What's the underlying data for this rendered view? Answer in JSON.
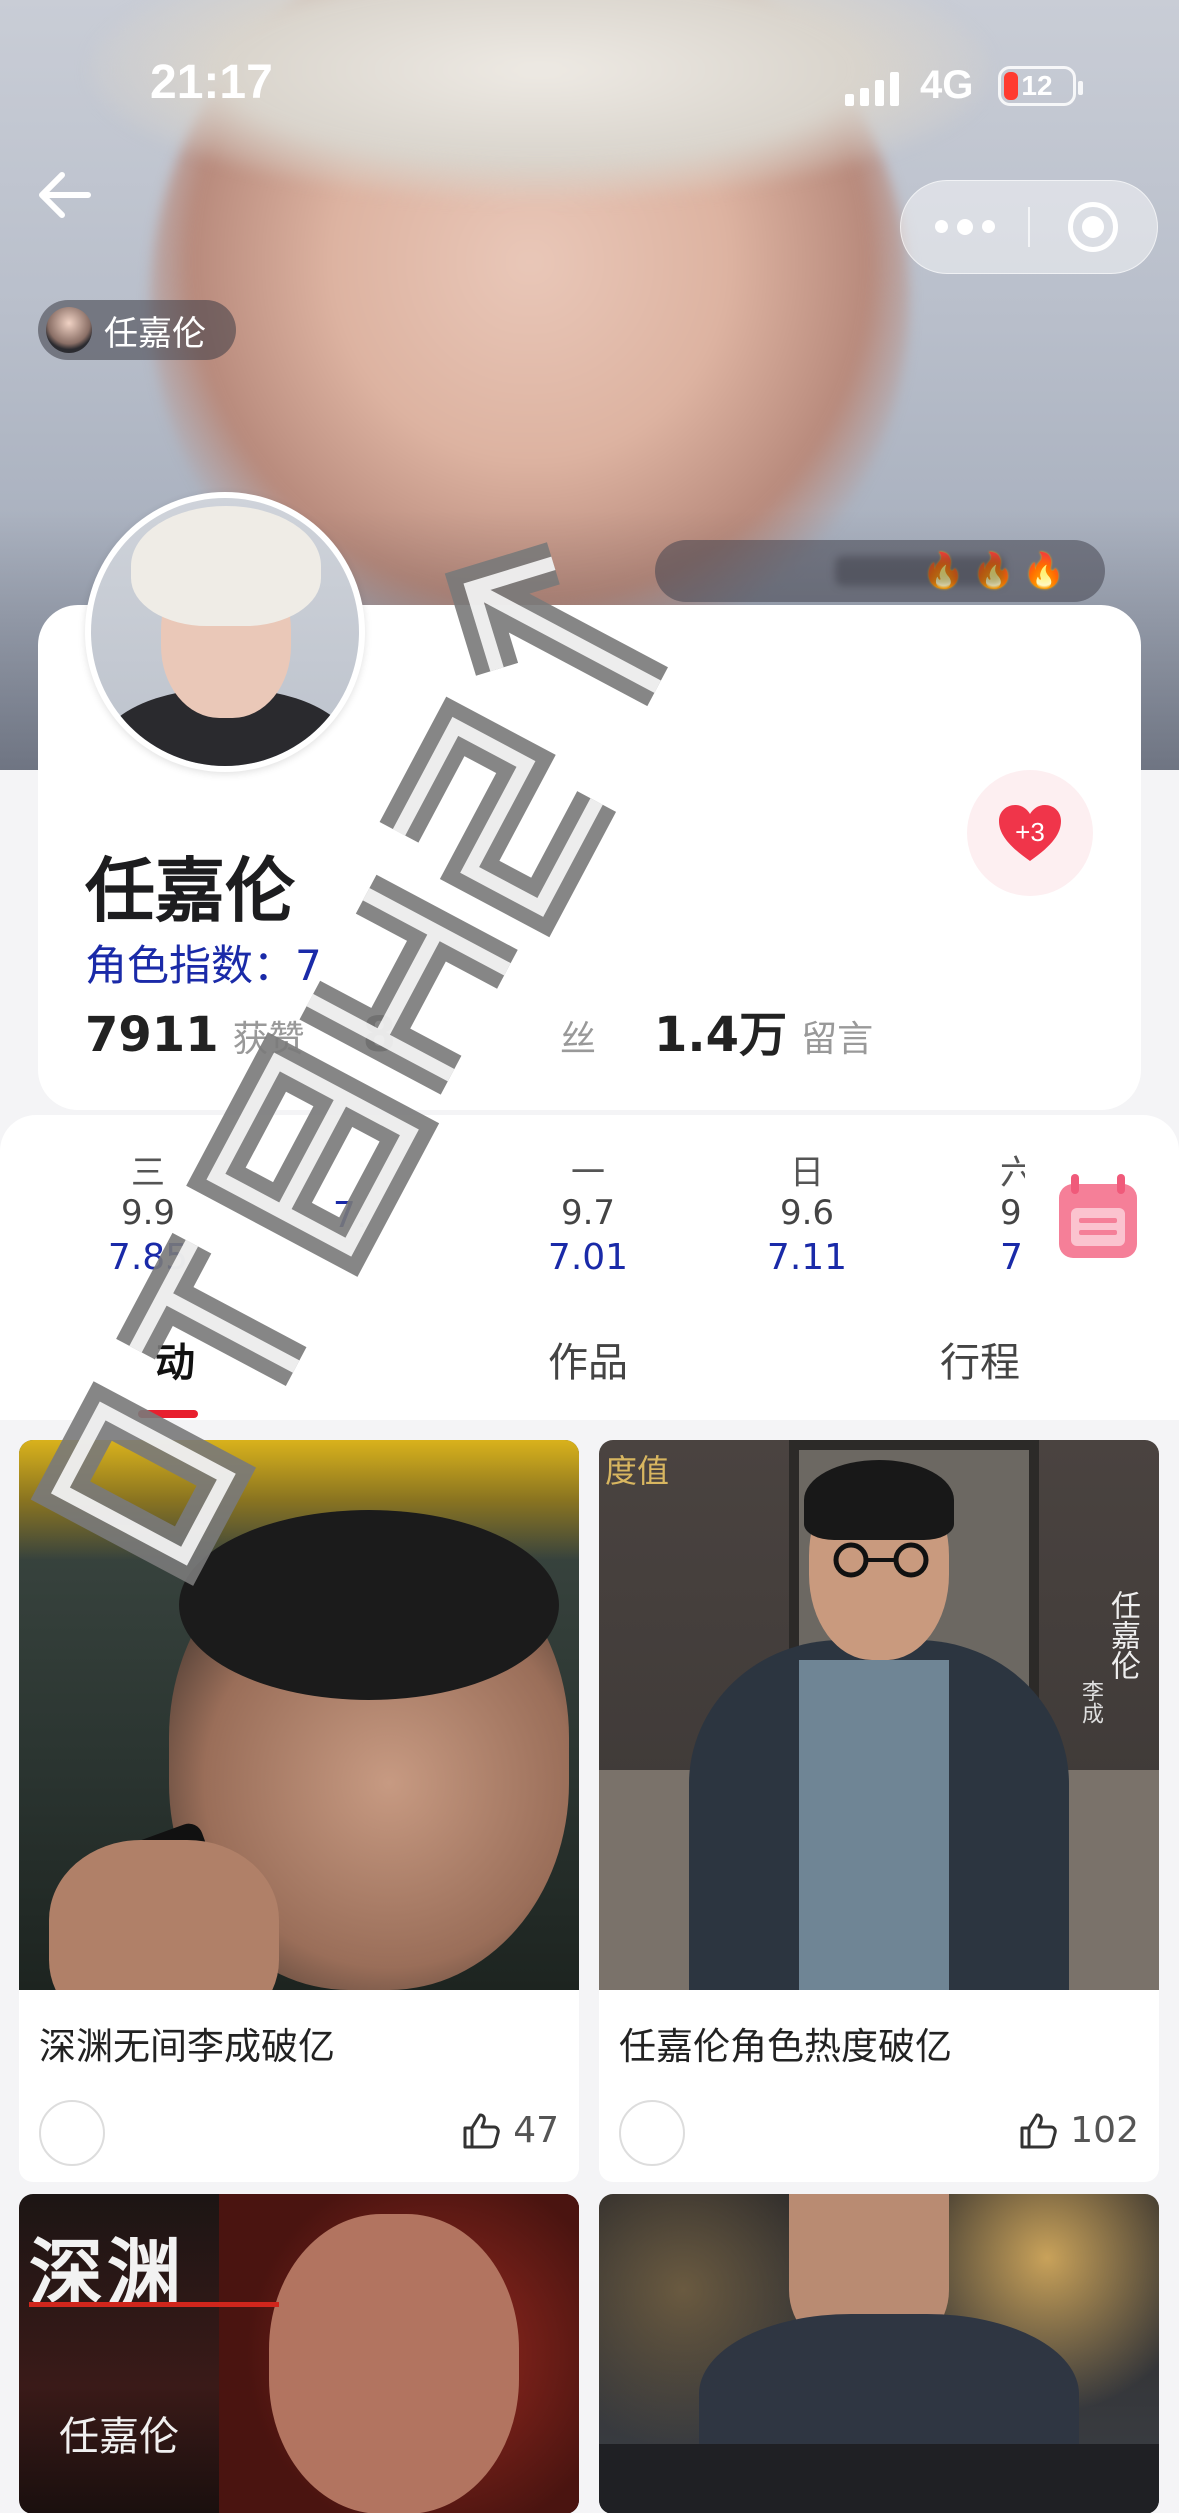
{
  "status_bar": {
    "time": "21:17",
    "network": "4G",
    "battery_level": "12",
    "battery_color": "#ff3b30"
  },
  "header": {
    "back_icon": "arrow-left-icon",
    "more_icon": "ellipsis-icon",
    "close_icon": "target-icon",
    "chip_name": "任嘉伦",
    "hot_flames": [
      "🔥",
      "🔥",
      "🔥"
    ]
  },
  "profile": {
    "name": "任嘉伦",
    "role_index_label": "角色指数：7",
    "like_badge": "+3",
    "like_badge_color": "#f0354a",
    "stats": [
      {
        "value": "7911",
        "label": "获赞"
      },
      {
        "value": "8",
        "label": "丝"
      },
      {
        "value": "1.4万",
        "label": "留言"
      }
    ]
  },
  "schedule": {
    "days": [
      {
        "name": "三",
        "date": "9.9",
        "score": "7.85"
      },
      {
        "name": "",
        "date": "",
        "score": "7."
      },
      {
        "name": "一",
        "date": "9.7",
        "score": "7.01"
      },
      {
        "name": "日",
        "date": "9.6",
        "score": "7.11"
      },
      {
        "name": "六",
        "date": "9",
        "score": "7."
      }
    ],
    "calendar_icon": "calendar-icon",
    "accent_color": "#1a2aa8"
  },
  "tabs": [
    {
      "label": "动",
      "active": true
    },
    {
      "label": "作品",
      "active": false
    },
    {
      "label": "行程",
      "active": false
    }
  ],
  "feed": [
    {
      "title": "深渊无间李成破亿",
      "likes": "47"
    },
    {
      "title": "任嘉伦角色热度破亿",
      "likes": "102",
      "poster_name": "任嘉伦",
      "poster_role": "李成",
      "poster_corner": "度值"
    },
    {
      "title": "",
      "likes": "",
      "poster_title": "深渊",
      "poster_name": "任嘉伦"
    },
    {
      "title": "",
      "likes": ""
    }
  ],
  "watermark": {
    "color": "#6f6f6f"
  }
}
